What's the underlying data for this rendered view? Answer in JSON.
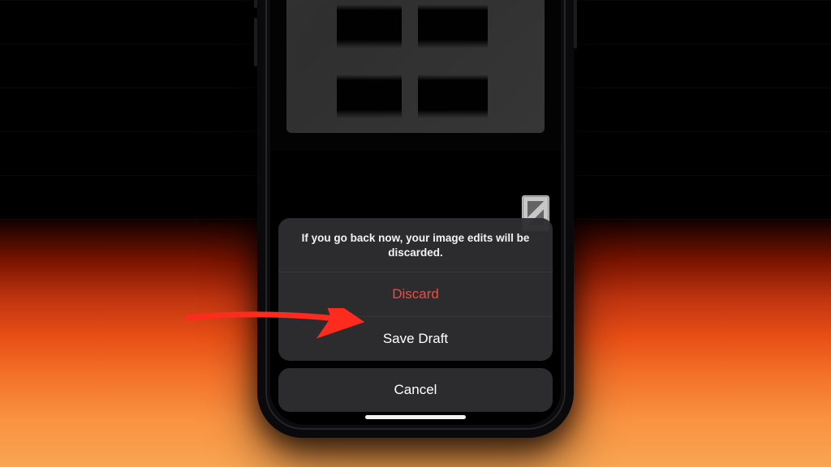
{
  "colors": {
    "destructive": "#ff453a",
    "arrow": "#ff2b1e"
  },
  "action_sheet": {
    "message": "If you go back now, your image edits will be discarded.",
    "discard_label": "Discard",
    "save_draft_label": "Save Draft",
    "cancel_label": "Cancel"
  }
}
